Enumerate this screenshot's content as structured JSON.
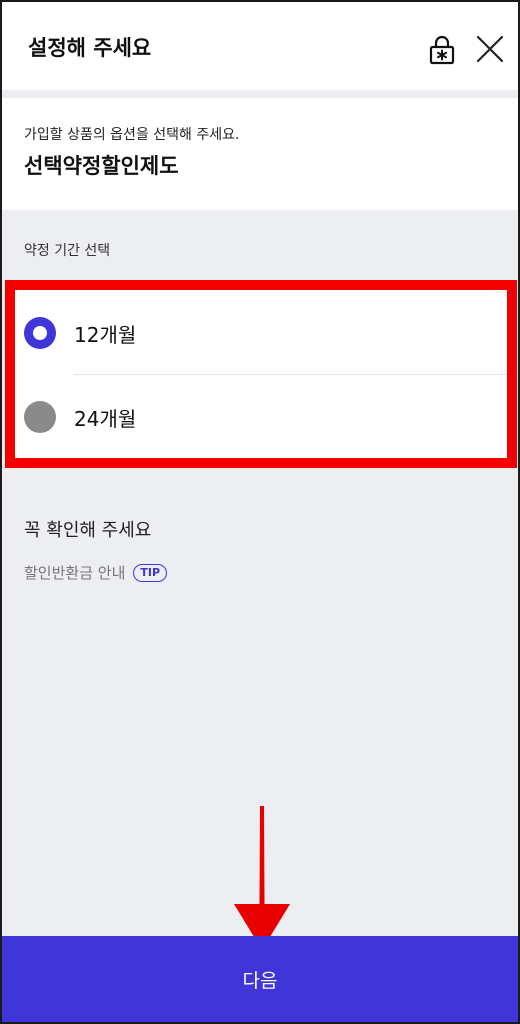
{
  "header": {
    "title": "설정해 주세요",
    "lock_icon": "lock-keypad-icon",
    "close_icon": "close-icon"
  },
  "product": {
    "subtitle": "가입할 상품의 옵션을 선택해 주세요.",
    "title": "선택약정할인제도"
  },
  "contract": {
    "label": "약정 기간 선택",
    "options": [
      {
        "label": "12개월",
        "selected": true
      },
      {
        "label": "24개월",
        "selected": false
      }
    ]
  },
  "notice": {
    "title": "꼭 확인해 주세요",
    "link_text": "할인반환금 안내",
    "badge": "TIP"
  },
  "footer": {
    "next_label": "다음"
  },
  "colors": {
    "accent": "#3f35d8",
    "highlight": "#f50000",
    "unselected": "#8a8a8a",
    "background": "#eceef1"
  }
}
